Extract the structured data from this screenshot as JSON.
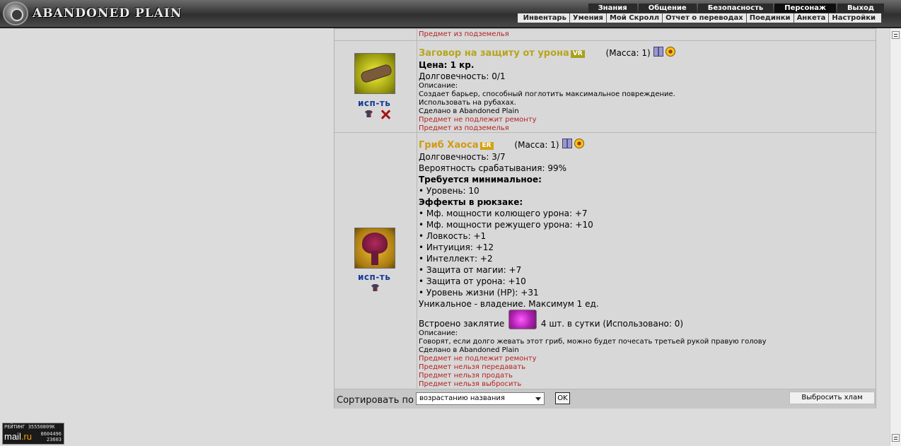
{
  "header": {
    "logo_text": "ABANDONED PLAIN",
    "top_menu": [
      "Знания",
      "Общение",
      "Безопасность",
      "Персонаж",
      "Выход"
    ],
    "active_top": "Персонаж",
    "sub_menu": [
      "Инвентарь",
      "Умения",
      "Мой Скролл",
      "Отчет о переводах",
      "Поединки",
      "Анкета",
      "Настройки"
    ]
  },
  "prev_item_tail": "Предмет из подземелья",
  "items": [
    {
      "name": "Заговор на защиту от урона",
      "badge": "VR",
      "mass": "(Масса: 1)",
      "use_label": "исп-ть",
      "price": "Цена: 1 кр.",
      "durability": "Долговечность: 0/1",
      "desc_label": "Описание:",
      "desc_lines": [
        "Создает барьер, способный поглотить максимальное повреждение.",
        "Использовать на рубахах.",
        "Сделано в Abandoned Plain"
      ],
      "red_notes": [
        "Предмет не подлежит ремонту",
        "Предмет из подземелья"
      ]
    },
    {
      "name": "Гриб Хаоса",
      "badge": "ER",
      "mass": "(Масса: 1)",
      "use_label": "исп-ть",
      "durability": "Долговечность: 3/7",
      "chance": "Вероятность срабатывания: 99%",
      "req_title": "Требуется минимальное:",
      "req_lines": [
        "• Уровень: 10"
      ],
      "effects_title": "Эффекты в рюкзаке:",
      "effects": [
        "• Мф. мощности колющего урона: +7",
        "• Мф. мощности режущего урона: +10",
        "• Ловкость: +1",
        "• Интуиция: +12",
        "• Интеллект: +2",
        "• Защита от магии: +7",
        "• Защита от урона: +10",
        "• Уровень жизни (HP): +31"
      ],
      "unique": "Уникальное - владение. Максимум 1 ед.",
      "spell_prefix": "Встроено заклятие",
      "spell_suffix": "4 шт. в сутки (Использовано: 0)",
      "desc_label": "Описание:",
      "desc_lines": [
        "Говорят, если долго жевать этот гриб, можно будет почесать третьей рукой правую голову",
        "Сделано в Abandoned Plain"
      ],
      "red_notes": [
        "Предмет не подлежит ремонту",
        "Предмет нельзя передавать",
        "Предмет нельзя продать",
        "Предмет нельзя выбросить"
      ]
    }
  ],
  "sort": {
    "label": "Сортировать по",
    "selected": "возрастанию названия",
    "ok": "OK",
    "junk_button": "Выбросить хлам"
  },
  "counter": {
    "line1": "РЕЙТИНГ 35550809К",
    "brand_main": "mail",
    "brand_suffix": ".ru",
    "num1": "8604496",
    "num2": "23603"
  }
}
